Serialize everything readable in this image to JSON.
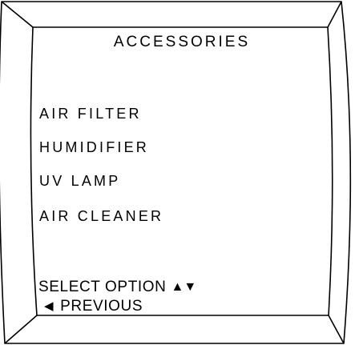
{
  "screen": {
    "title": "ACCESSORIES",
    "items": [
      {
        "label": "AIR FILTER"
      },
      {
        "label": "HUMIDIFIER"
      },
      {
        "label": "UV LAMP"
      },
      {
        "label": "AIR CLEANER"
      }
    ],
    "hints": {
      "select_label": "SELECT OPTION",
      "select_icon": "up-down-arrows-icon",
      "select_glyph": "▲▼",
      "previous_label": "PREVIOUS",
      "previous_icon": "left-arrow-icon",
      "previous_glyph": "◀"
    }
  },
  "colors": {
    "background": "#ffffff",
    "foreground": "#000000"
  }
}
